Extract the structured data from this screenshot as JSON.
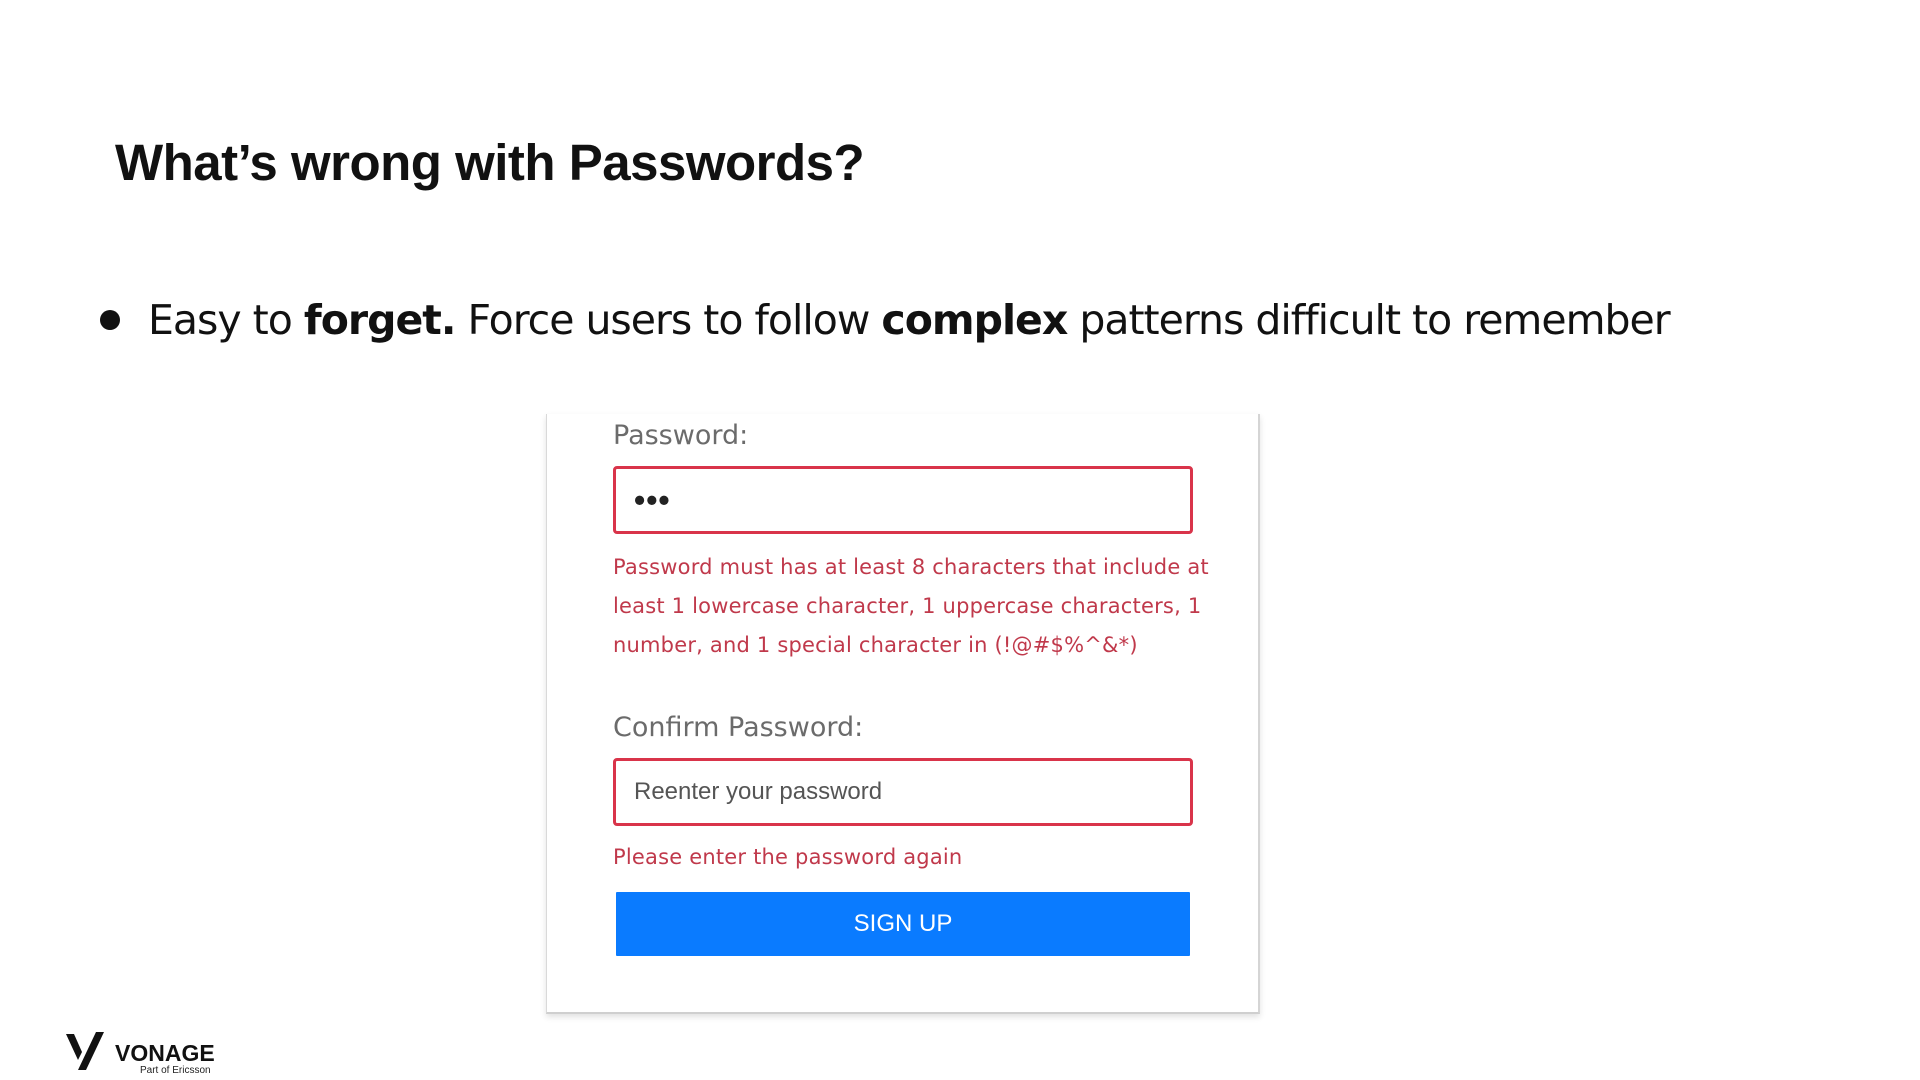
{
  "slide": {
    "title": "What’s wrong with Passwords?",
    "bullet": {
      "text_1": "Easy to ",
      "bold_1": "forget.",
      "text_2": " Force users to follow ",
      "bold_2": "complex",
      "text_3": " patterns difficult to remember"
    }
  },
  "form": {
    "password_label": "Password:",
    "password_value": "•••",
    "password_error": "Password must has at least 8 characters that include at least 1 lowercase character, 1 uppercase characters, 1 number, and 1 special character in (!@#$%^&*)",
    "confirm_label": "Confirm Password:",
    "confirm_placeholder": "Reenter your password",
    "confirm_error": "Please enter the password again",
    "signup_label": "SIGN UP"
  },
  "brand": {
    "name": "VONAGE",
    "subtitle": "Part of Ericsson",
    "icon": "vonage-v-logo"
  },
  "colors": {
    "error": "#c0394b",
    "input_border": "#d9344a",
    "button": "#0a7bff"
  }
}
